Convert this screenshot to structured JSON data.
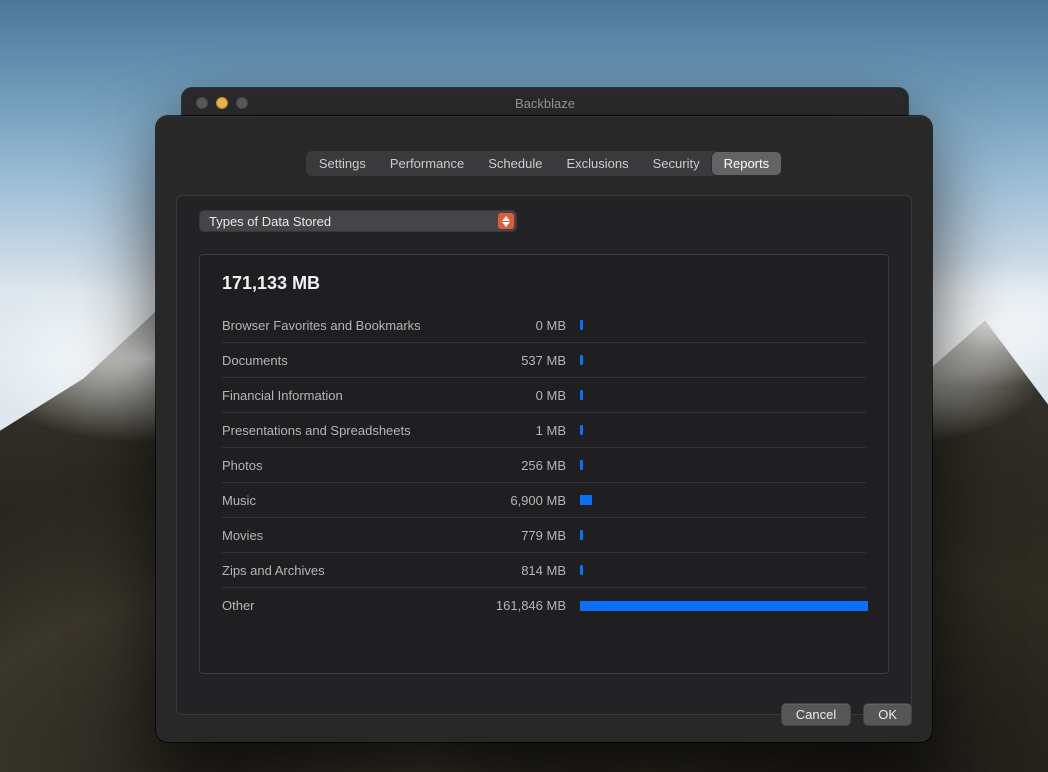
{
  "window_title": "Backblaze",
  "tabs": [
    "Settings",
    "Performance",
    "Schedule",
    "Exclusions",
    "Security",
    "Reports"
  ],
  "active_tab_index": 5,
  "dropdown": {
    "label": "Types of Data Stored"
  },
  "total_label": "171,133 MB",
  "unit": "MB",
  "rows": [
    {
      "label": "Browser Favorites and Bookmarks",
      "value": "0 MB",
      "mb": 0
    },
    {
      "label": "Documents",
      "value": "537 MB",
      "mb": 537
    },
    {
      "label": "Financial Information",
      "value": "0 MB",
      "mb": 0
    },
    {
      "label": "Presentations and Spreadsheets",
      "value": "1 MB",
      "mb": 1
    },
    {
      "label": "Photos",
      "value": "256 MB",
      "mb": 256
    },
    {
      "label": "Music",
      "value": "6,900 MB",
      "mb": 6900
    },
    {
      "label": "Movies",
      "value": "779 MB",
      "mb": 779
    },
    {
      "label": "Zips and Archives",
      "value": "814 MB",
      "mb": 814
    },
    {
      "label": "Other",
      "value": "161,846 MB",
      "mb": 161846
    }
  ],
  "buttons": {
    "cancel": "Cancel",
    "ok": "OK"
  },
  "chart_data": {
    "type": "bar",
    "title": "Types of Data Stored",
    "total_mb": 171133,
    "categories": [
      "Browser Favorites and Bookmarks",
      "Documents",
      "Financial Information",
      "Presentations and Spreadsheets",
      "Photos",
      "Music",
      "Movies",
      "Zips and Archives",
      "Other"
    ],
    "values": [
      0,
      537,
      0,
      1,
      256,
      6900,
      779,
      814,
      161846
    ],
    "xlabel": "",
    "ylabel": "MB"
  }
}
